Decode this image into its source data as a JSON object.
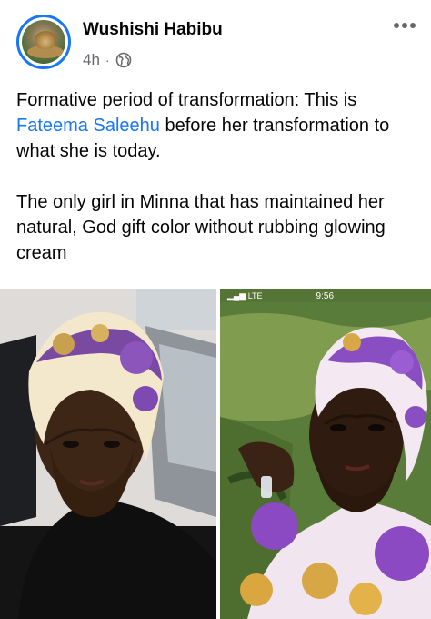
{
  "post": {
    "author": "Wushishi Habibu",
    "time": "4h",
    "separator": "·",
    "audience_icon": "globe-icon",
    "more_icon": "more-options-icon",
    "text_line1_before": "Formative period of transformation: This is ",
    "mention": "Fateema Saleehu",
    "text_line1_after": " before her transformation to what she is today.",
    "text_paragraph2": "The only girl in Minna that has maintained her natural, God gift color without rubbing glowing cream"
  },
  "photos": {
    "right_status_time": "9:56",
    "right_status_signal": "▂▄▆ LTE"
  },
  "colors": {
    "mention": "#1877f2",
    "secondary_text": "#65676b",
    "avatar_ring": "#1877f2"
  }
}
